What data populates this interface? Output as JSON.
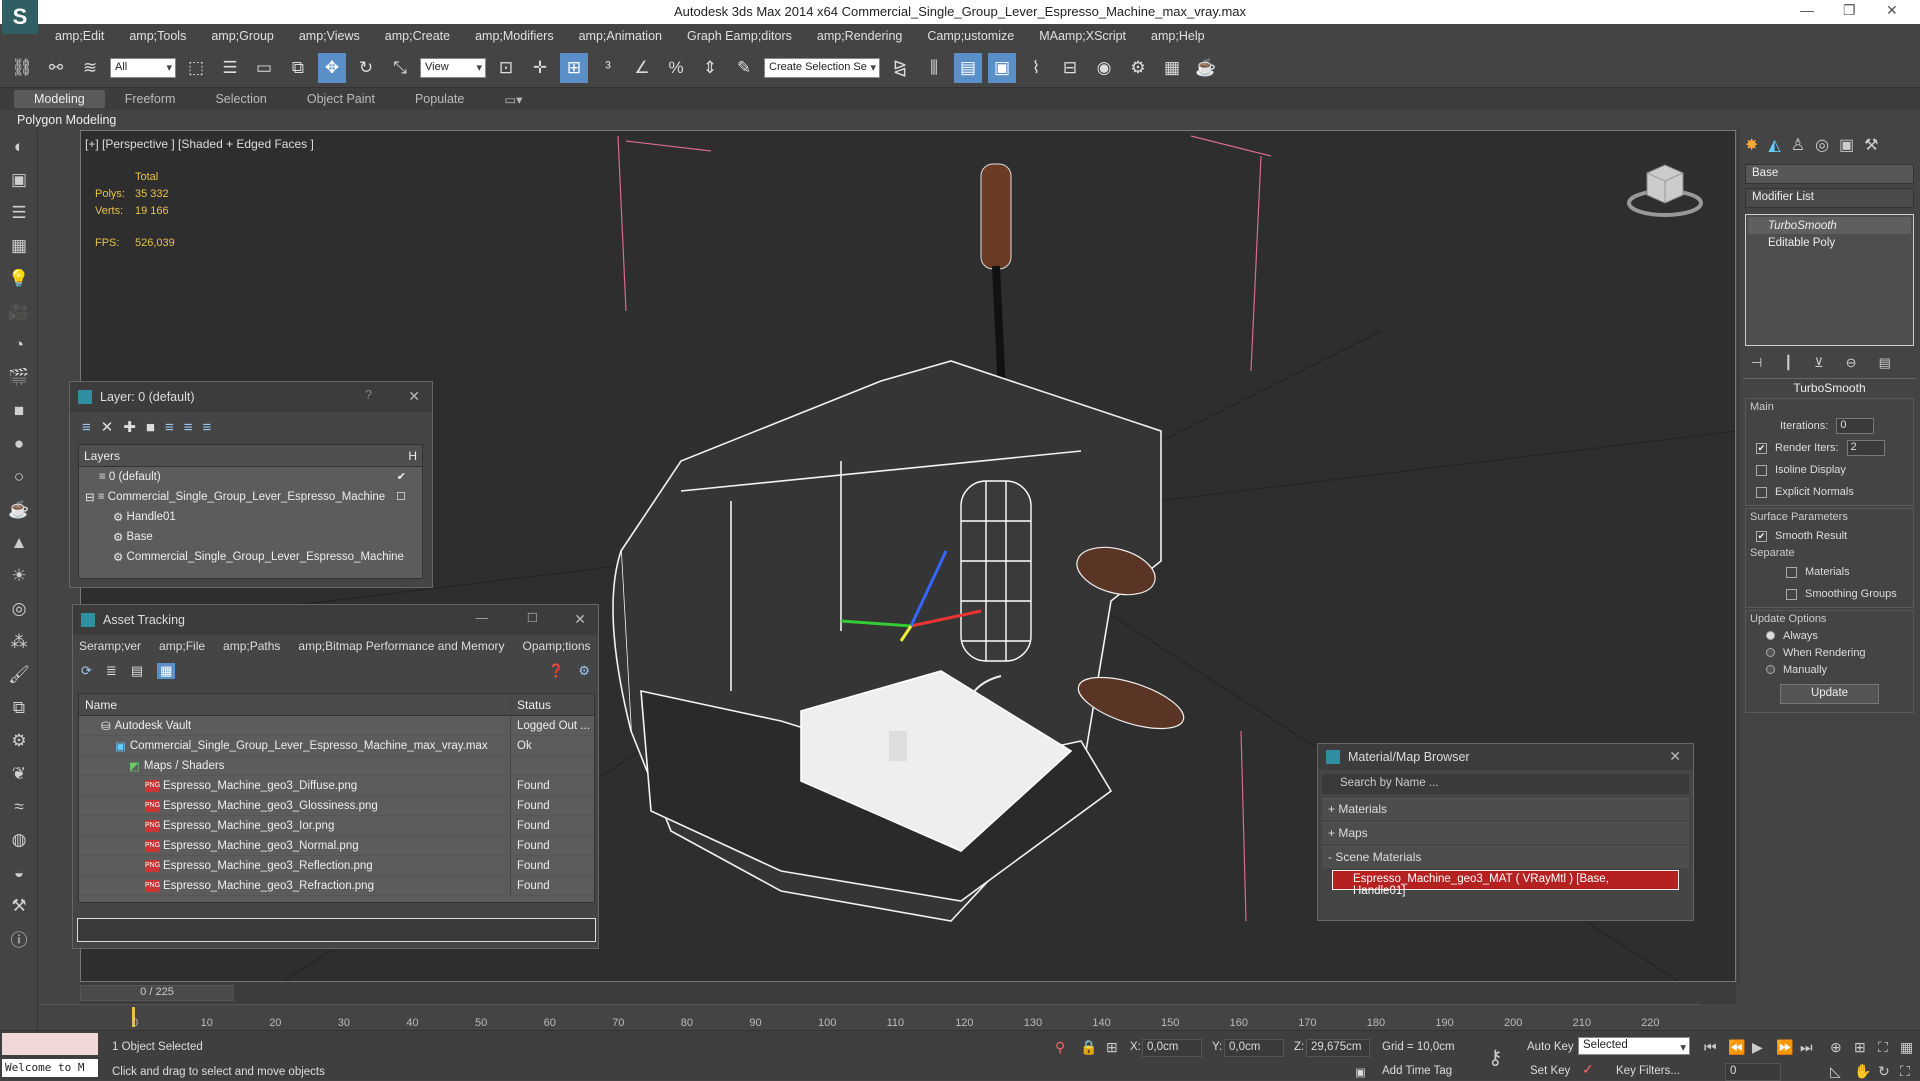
{
  "window": {
    "title": "Autodesk 3ds Max  2014 x64     Commercial_Single_Group_Lever_Espresso_Machine_max_vray.max"
  },
  "menu": [
    "amp;Edit",
    "amp;Tools",
    "amp;Group",
    "amp;Views",
    "amp;Create",
    "amp;Modifiers",
    "amp;Animation",
    "Graph Eamp;ditors",
    "amp;Rendering",
    "Camp;ustomize",
    "MAamp;XScript",
    "amp;Help"
  ],
  "toolbar": {
    "filter": "All",
    "refcoord": "View",
    "selset": "Create Selection Se"
  },
  "ribbon": {
    "tabs": [
      "Modeling",
      "Freeform",
      "Selection",
      "Object Paint",
      "Populate"
    ],
    "sub": "Polygon Modeling"
  },
  "viewport": {
    "label": "[+] [Perspective ] [Shaded + Edged Faces ]",
    "total_label": "Total",
    "polys_label": "Polys:",
    "polys": "35 332",
    "verts_label": "Verts:",
    "verts": "19 166",
    "fps_label": "FPS:",
    "fps": "526,039"
  },
  "layer": {
    "title": "Layer: 0 (default)",
    "help": "?",
    "col": "Layers",
    "col2": "H",
    "items": [
      "0 (default)",
      "Commercial_Single_Group_Lever_Espresso_Machine",
      "Handle01",
      "Base",
      "Commercial_Single_Group_Lever_Espresso_Machine"
    ]
  },
  "asset": {
    "title": "Asset Tracking",
    "menu": [
      "Seramp;ver",
      "amp;File",
      "amp;Paths",
      "amp;Bitmap Performance and Memory",
      "Opamp;tions"
    ],
    "col_name": "Name",
    "col_status": "Status",
    "rows": [
      {
        "name": "Autodesk Vault",
        "status": "Logged Out ..."
      },
      {
        "name": "Commercial_Single_Group_Lever_Espresso_Machine_max_vray.max",
        "status": "Ok"
      },
      {
        "name": "Maps / Shaders",
        "status": ""
      },
      {
        "name": "Espresso_Machine_geo3_Diffuse.png",
        "status": "Found"
      },
      {
        "name": "Espresso_Machine_geo3_Glossiness.png",
        "status": "Found"
      },
      {
        "name": "Espresso_Machine_geo3_Ior.png",
        "status": "Found"
      },
      {
        "name": "Espresso_Machine_geo3_Normal.png",
        "status": "Found"
      },
      {
        "name": "Espresso_Machine_geo3_Reflection.png",
        "status": "Found"
      },
      {
        "name": "Espresso_Machine_geo3_Refraction.png",
        "status": "Found"
      }
    ]
  },
  "matbrowser": {
    "title": "Material/Map Browser",
    "search": "Search by Name ...",
    "sections": [
      "+ Materials",
      "+ Maps",
      "- Scene Materials"
    ],
    "material": "Espresso_Machine_geo3_MAT ( VRayMtl ) [Base, Handle01]"
  },
  "cmd": {
    "name": "Base",
    "modlist": "Modifier List",
    "stack": [
      "TurboSmooth",
      "Editable Poly"
    ],
    "rollout": "TurboSmooth",
    "main": "Main",
    "iterations_label": "Iterations:",
    "iterations": "0",
    "render_iters_label": "Render Iters:",
    "render_iters": "2",
    "isoline": "Isoline Display",
    "explicit": "Explicit Normals",
    "surface": "Surface Parameters",
    "smooth": "Smooth Result",
    "separate": "Separate",
    "materials": "Materials",
    "smoothing": "Smoothing Groups",
    "update_opts": "Update Options",
    "always": "Always",
    "when_rendering": "When Rendering",
    "manually": "Manually",
    "update": "Update"
  },
  "timeline": {
    "frame": "0 / 225",
    "ticks": [
      "0",
      "10",
      "20",
      "30",
      "40",
      "50",
      "60",
      "70",
      "80",
      "90",
      "100",
      "110",
      "120",
      "130",
      "140",
      "150",
      "160",
      "170",
      "180",
      "190",
      "200",
      "210",
      "220"
    ]
  },
  "status": {
    "welcome": "Welcome to M",
    "selected": "1 Object Selected",
    "prompt": "Click and drag to select and move objects",
    "x_label": "X:",
    "x": "0,0cm",
    "y_label": "Y:",
    "y": "0,0cm",
    "z_label": "Z:",
    "z": "29,675cm",
    "grid": "Grid = 10,0cm",
    "autokey": "Auto Key",
    "selmode": "Selected",
    "setkey": "Set Key",
    "keyfilters": "Key Filters...",
    "addtime": "Add Time Tag",
    "frame": "0"
  }
}
